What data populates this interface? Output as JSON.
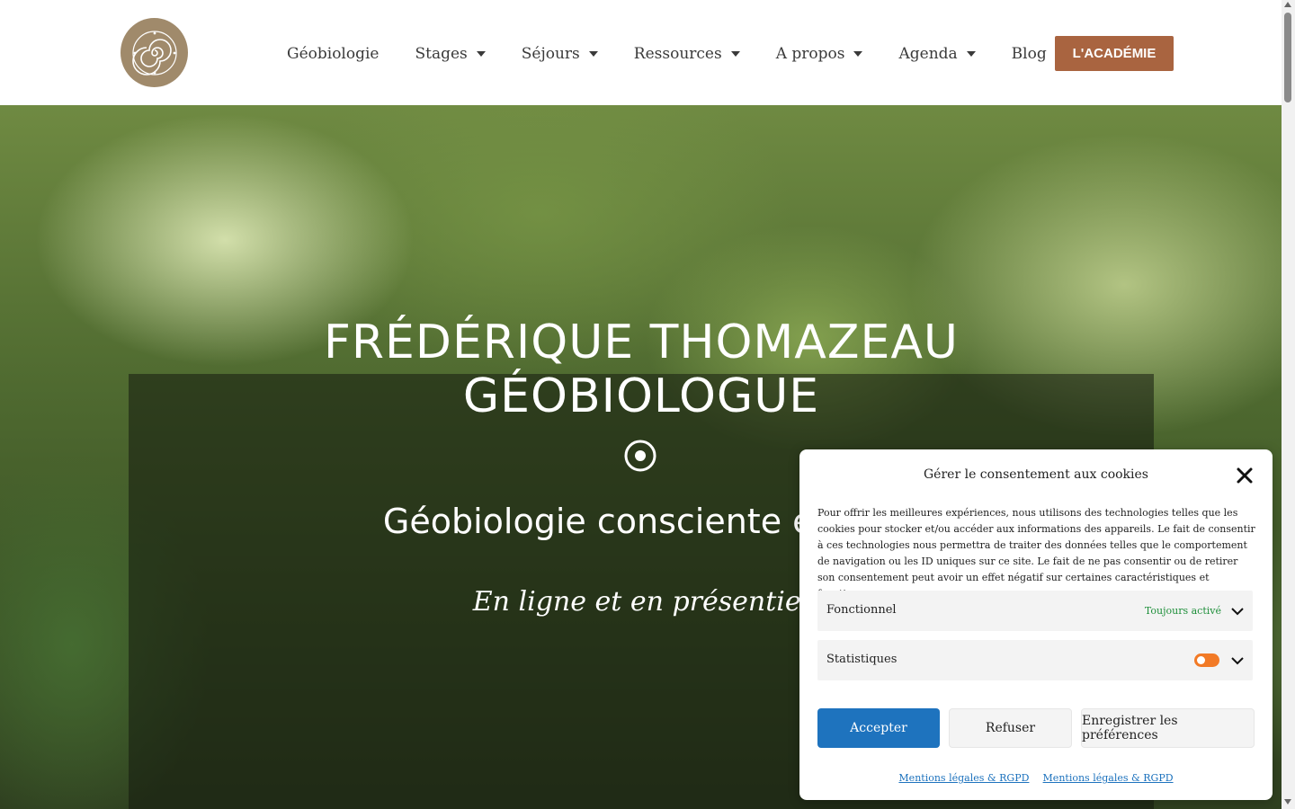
{
  "header": {
    "logo_icon": "spiral-logo-icon",
    "nav": [
      {
        "label": "Géobiologie",
        "dropdown": false
      },
      {
        "label": "Stages",
        "dropdown": true
      },
      {
        "label": "Séjours",
        "dropdown": true
      },
      {
        "label": "Ressources",
        "dropdown": true
      },
      {
        "label": "A propos",
        "dropdown": true
      },
      {
        "label": "Agenda",
        "dropdown": true
      },
      {
        "label": "Blog",
        "dropdown": false
      }
    ],
    "cta_label": "L'ACADÉMIE",
    "cta_color": "#a96440"
  },
  "hero": {
    "title_line1": "FRÉDÉRIQUE THOMAZEAU",
    "title_line2": "GÉOBIOLOGUE",
    "subtitle": "Géobiologie consciente et lieu",
    "script": "En ligne et en présentiel",
    "icon": "target-circle-icon"
  },
  "cookie": {
    "title": "Gérer le consentement aux cookies",
    "text": "Pour offrir les meilleures expériences, nous utilisons des technologies telles que les cookies pour stocker et/ou accéder aux informations des appareils. Le fait de consentir à ces technologies nous permettra de traiter des données telles que le comportement de navigation ou les ID uniques sur ce site. Le fait de ne pas consentir ou de retirer son consentement peut avoir un effet négatif sur certaines caractéristiques et fonctions.",
    "functional_label": "Fonctionnel",
    "functional_status": "Toujours activé",
    "statistics_label": "Statistiques",
    "accept_label": "Accepter",
    "refuse_label": "Refuser",
    "prefs_label": "Enregistrer les préférences",
    "link1": "Mentions légales & RGPD",
    "link2": "Mentions légales & RGPD",
    "accept_color": "#1e73be",
    "toggle_color": "#f27a26"
  }
}
